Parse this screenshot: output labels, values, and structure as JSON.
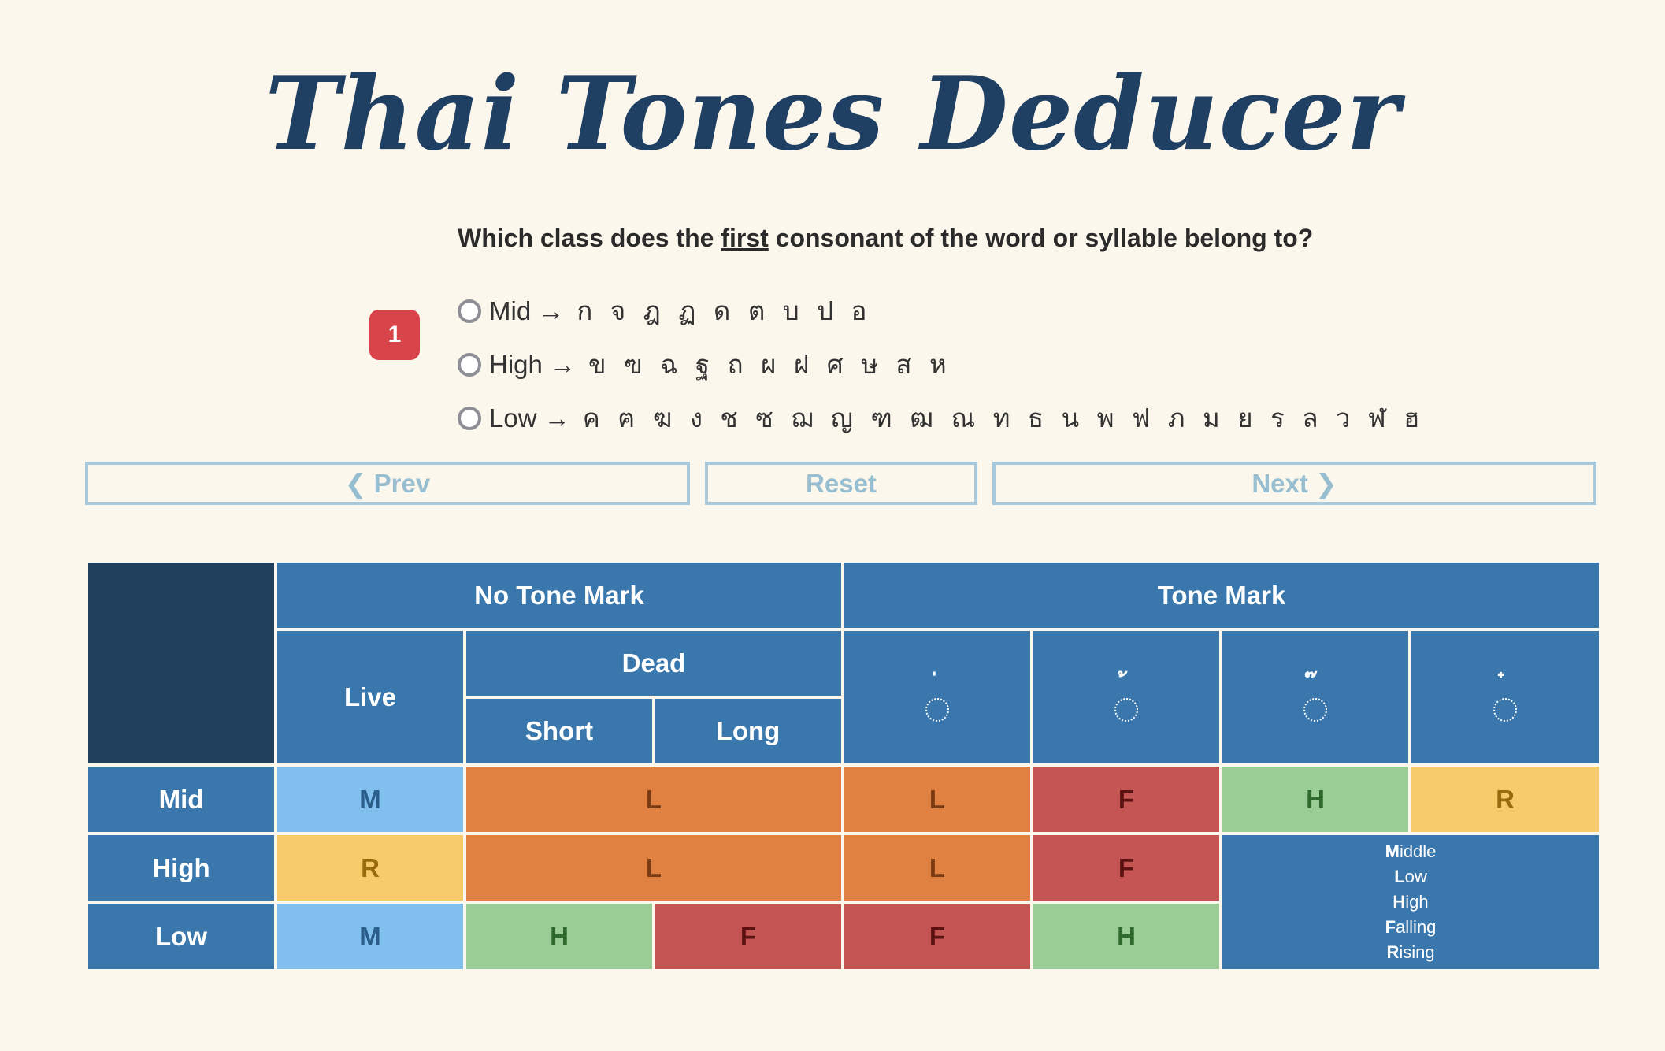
{
  "title": "Thai Tones Deducer",
  "question": {
    "before": "Which class does the ",
    "emphasis": "first",
    "after": " consonant of the word or syllable belong to?"
  },
  "step_number": "1",
  "options": [
    {
      "label": "Mid →",
      "consonants": "ก จ ฎ ฏ ด ต บ ป อ"
    },
    {
      "label": "High →",
      "consonants": "ข ฃ ฉ ฐ ถ ผ ฝ ศ ษ ส ห"
    },
    {
      "label": "Low →",
      "consonants": "ค ฅ ฆ ง ช ซ ฌ ญ ฑ ฒ ณ ท ธ น พ ฟ ภ ม ย ร ล ว ฬ ฮ"
    }
  ],
  "nav": {
    "prev": "❮ Prev",
    "reset": "Reset",
    "next": "Next ❯"
  },
  "table": {
    "no_tone_mark": "No Tone Mark",
    "tone_mark": "Tone Mark",
    "live": "Live",
    "dead": "Dead",
    "short": "Short",
    "long": "Long",
    "tone_marks": [
      "่",
      "้",
      "๊",
      "๋"
    ],
    "rows": {
      "mid": {
        "label": "Mid",
        "live": "M",
        "dead": "L",
        "mark1": "L",
        "mark2": "F",
        "mark3": "H",
        "mark4": "R"
      },
      "high": {
        "label": "High",
        "live": "R",
        "dead": "L",
        "mark1": "L",
        "mark2": "F"
      },
      "low": {
        "label": "Low",
        "live": "M",
        "short": "H",
        "long": "F",
        "mark1": "F",
        "mark2": "H"
      }
    },
    "legend": [
      {
        "initial": "M",
        "rest": "iddle"
      },
      {
        "initial": "L",
        "rest": "ow"
      },
      {
        "initial": "H",
        "rest": "igh"
      },
      {
        "initial": "F",
        "rest": "alling"
      },
      {
        "initial": "R",
        "rest": "ising"
      }
    ]
  },
  "colors": {
    "background": "#fcf7ec",
    "title": "#1f3f63",
    "header": "#3a77ad",
    "corner": "#1f3f5c",
    "badge": "#d9434a",
    "mid_tone": "#80bfee",
    "low_tone": "#e08142",
    "falling_tone": "#c45553",
    "high_tone": "#9acd95",
    "rising_tone": "#f7ca6a",
    "button_border": "#a9c8da"
  }
}
